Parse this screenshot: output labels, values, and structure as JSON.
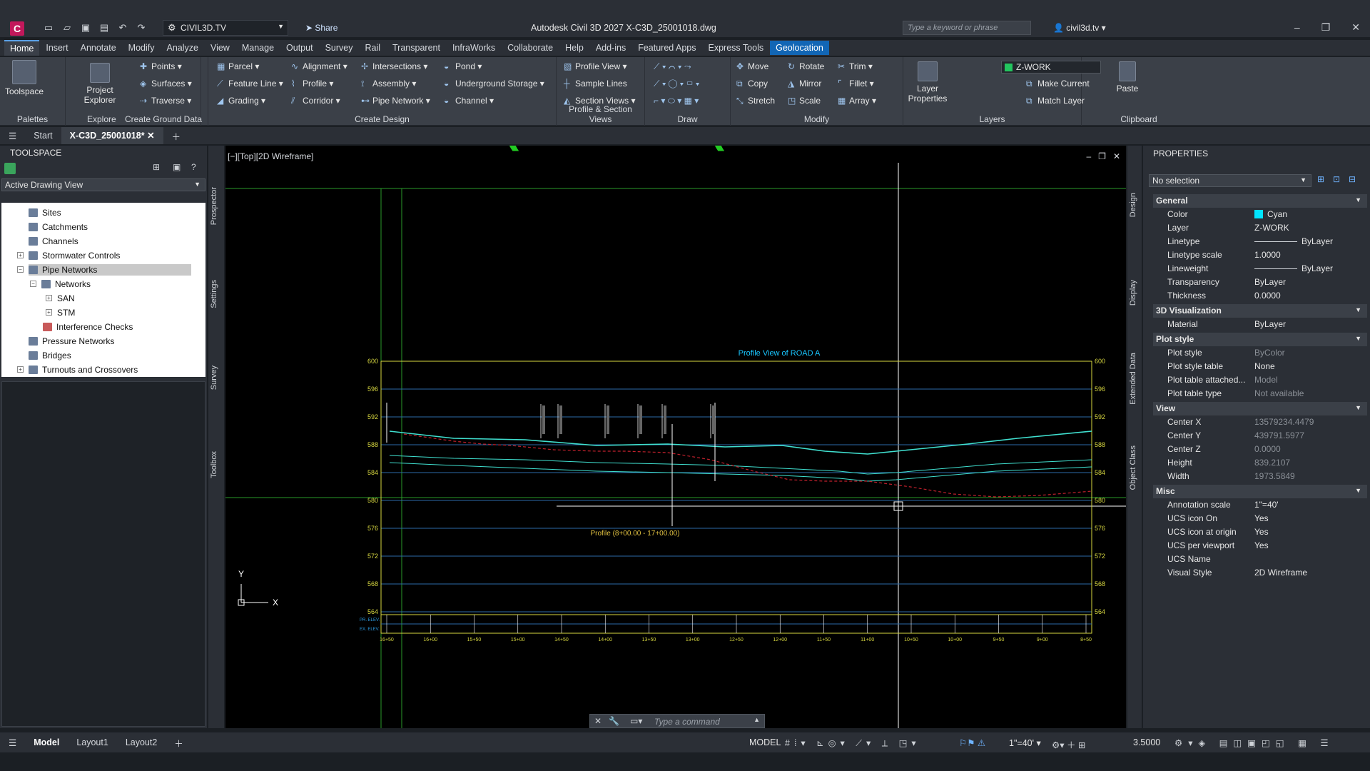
{
  "titlebar": {
    "workspace": "CIVIL3D.TV",
    "share_label": "Share",
    "window_title": "Autodesk Civil 3D 2027   X-C3D_25001018.dwg",
    "search_placeholder": "Type a keyword or phrase",
    "user": "civil3d.tv"
  },
  "menu_tabs": [
    "Home",
    "Insert",
    "Annotate",
    "Modify",
    "Analyze",
    "View",
    "Manage",
    "Output",
    "Survey",
    "Rail",
    "Transparent",
    "InfraWorks",
    "Collaborate",
    "Help",
    "Add-ins",
    "Featured Apps",
    "Express Tools",
    "Geolocation"
  ],
  "ribbon": {
    "palettes": {
      "toolspace": "Toolspace",
      "title": "Palettes"
    },
    "explore": {
      "project_explorer": "Project Explorer",
      "title": "Explore"
    },
    "ground": {
      "points": "Points",
      "surfaces": "Surfaces",
      "traverse": "Traverse",
      "title": "Create Ground Data"
    },
    "design": {
      "parcel": "Parcel",
      "feature_line": "Feature Line",
      "grading": "Grading",
      "alignment": "Alignment",
      "profile": "Profile",
      "corridor": "Corridor",
      "intersections": "Intersections",
      "assembly": "Assembly",
      "pipe_network": "Pipe Network",
      "pond": "Pond",
      "underground_storage": "Underground Storage",
      "channel": "Channel",
      "title": "Create Design"
    },
    "profile_section": {
      "profile_view": "Profile View",
      "sample_lines": "Sample Lines",
      "section_views": "Section Views",
      "title": "Profile & Section Views"
    },
    "draw": {
      "title": "Draw"
    },
    "modify": {
      "move": "Move",
      "copy": "Copy",
      "stretch": "Stretch",
      "rotate": "Rotate",
      "mirror": "Mirror",
      "scale": "Scale",
      "trim": "Trim",
      "fillet": "Fillet",
      "array": "Array",
      "title": "Modify"
    },
    "layers": {
      "layer_properties": "Layer Properties",
      "current_layer": "Z-WORK",
      "make_current": "Make Current",
      "match_layer": "Match Layer",
      "title": "Layers"
    },
    "clipboard": {
      "paste": "Paste",
      "title": "Clipboard"
    }
  },
  "doc_tabs": {
    "start": "Start",
    "active": "X-C3D_25001018*"
  },
  "toolspace": {
    "title": "TOOLSPACE",
    "view_select": "Active Drawing View",
    "tree": [
      "Sites",
      "Catchments",
      "Channels",
      "Stormwater Controls",
      "Pipe Networks",
      "Networks",
      "SAN",
      "STM",
      "Interference Checks",
      "Pressure Networks",
      "Bridges",
      "Turnouts and Crossovers"
    ],
    "side_tabs": [
      "Prospector",
      "Settings",
      "Survey",
      "Toolbox"
    ]
  },
  "viewport": {
    "label": "[−][Top][2D Wireframe]",
    "profile_title": "Profile View of  ROAD A",
    "profile_footer": "Profile (8+00.00 - 17+00.00)",
    "elevations": [
      "600",
      "596",
      "592",
      "588",
      "584",
      "580",
      "576",
      "572",
      "568",
      "564"
    ],
    "stations": [
      "16+50",
      "16+00",
      "15+50",
      "15+00",
      "14+50",
      "14+00",
      "13+50",
      "13+00",
      "12+50",
      "12+00",
      "11+50",
      "11+00",
      "10+50",
      "10+00",
      "9+50",
      "9+00",
      "8+50"
    ],
    "band_labels": [
      "PR. ELEV.",
      "EX. ELEV."
    ],
    "command_placeholder": "Type a command"
  },
  "properties": {
    "title": "PROPERTIES",
    "selection": "No selection",
    "side_tabs": [
      "Design",
      "Display",
      "Extended Data",
      "Object Class"
    ],
    "sections": [
      {
        "name": "General",
        "rows": [
          {
            "k": "Color",
            "v": "Cyan"
          },
          {
            "k": "Layer",
            "v": "Z-WORK"
          },
          {
            "k": "Linetype",
            "v": "ByLayer"
          },
          {
            "k": "Linetype scale",
            "v": "1.0000"
          },
          {
            "k": "Lineweight",
            "v": "ByLayer"
          },
          {
            "k": "Transparency",
            "v": "ByLayer"
          },
          {
            "k": "Thickness",
            "v": "0.0000"
          }
        ]
      },
      {
        "name": "3D Visualization",
        "rows": [
          {
            "k": "Material",
            "v": "ByLayer"
          }
        ]
      },
      {
        "name": "Plot style",
        "rows": [
          {
            "k": "Plot style",
            "v": "ByColor"
          },
          {
            "k": "Plot style table",
            "v": "None"
          },
          {
            "k": "Plot table attached...",
            "v": "Model"
          },
          {
            "k": "Plot table type",
            "v": "Not available"
          }
        ]
      },
      {
        "name": "View",
        "rows": [
          {
            "k": "Center X",
            "v": "13579234.4479"
          },
          {
            "k": "Center Y",
            "v": "439791.5977"
          },
          {
            "k": "Center Z",
            "v": "0.0000"
          },
          {
            "k": "Height",
            "v": "839.2107"
          },
          {
            "k": "Width",
            "v": "1973.5849"
          }
        ]
      },
      {
        "name": "Misc",
        "rows": [
          {
            "k": "Annotation scale",
            "v": "1\"=40'"
          },
          {
            "k": "UCS icon On",
            "v": "Yes"
          },
          {
            "k": "UCS icon at origin",
            "v": "Yes"
          },
          {
            "k": "UCS per viewport",
            "v": "Yes"
          },
          {
            "k": "UCS Name",
            "v": ""
          },
          {
            "k": "Visual Style",
            "v": "2D Wireframe"
          }
        ]
      }
    ]
  },
  "statusbar": {
    "layouts": [
      "Model",
      "Layout1",
      "Layout2"
    ],
    "model": "MODEL",
    "scale": "1\"=40'",
    "value": "3.5000"
  }
}
